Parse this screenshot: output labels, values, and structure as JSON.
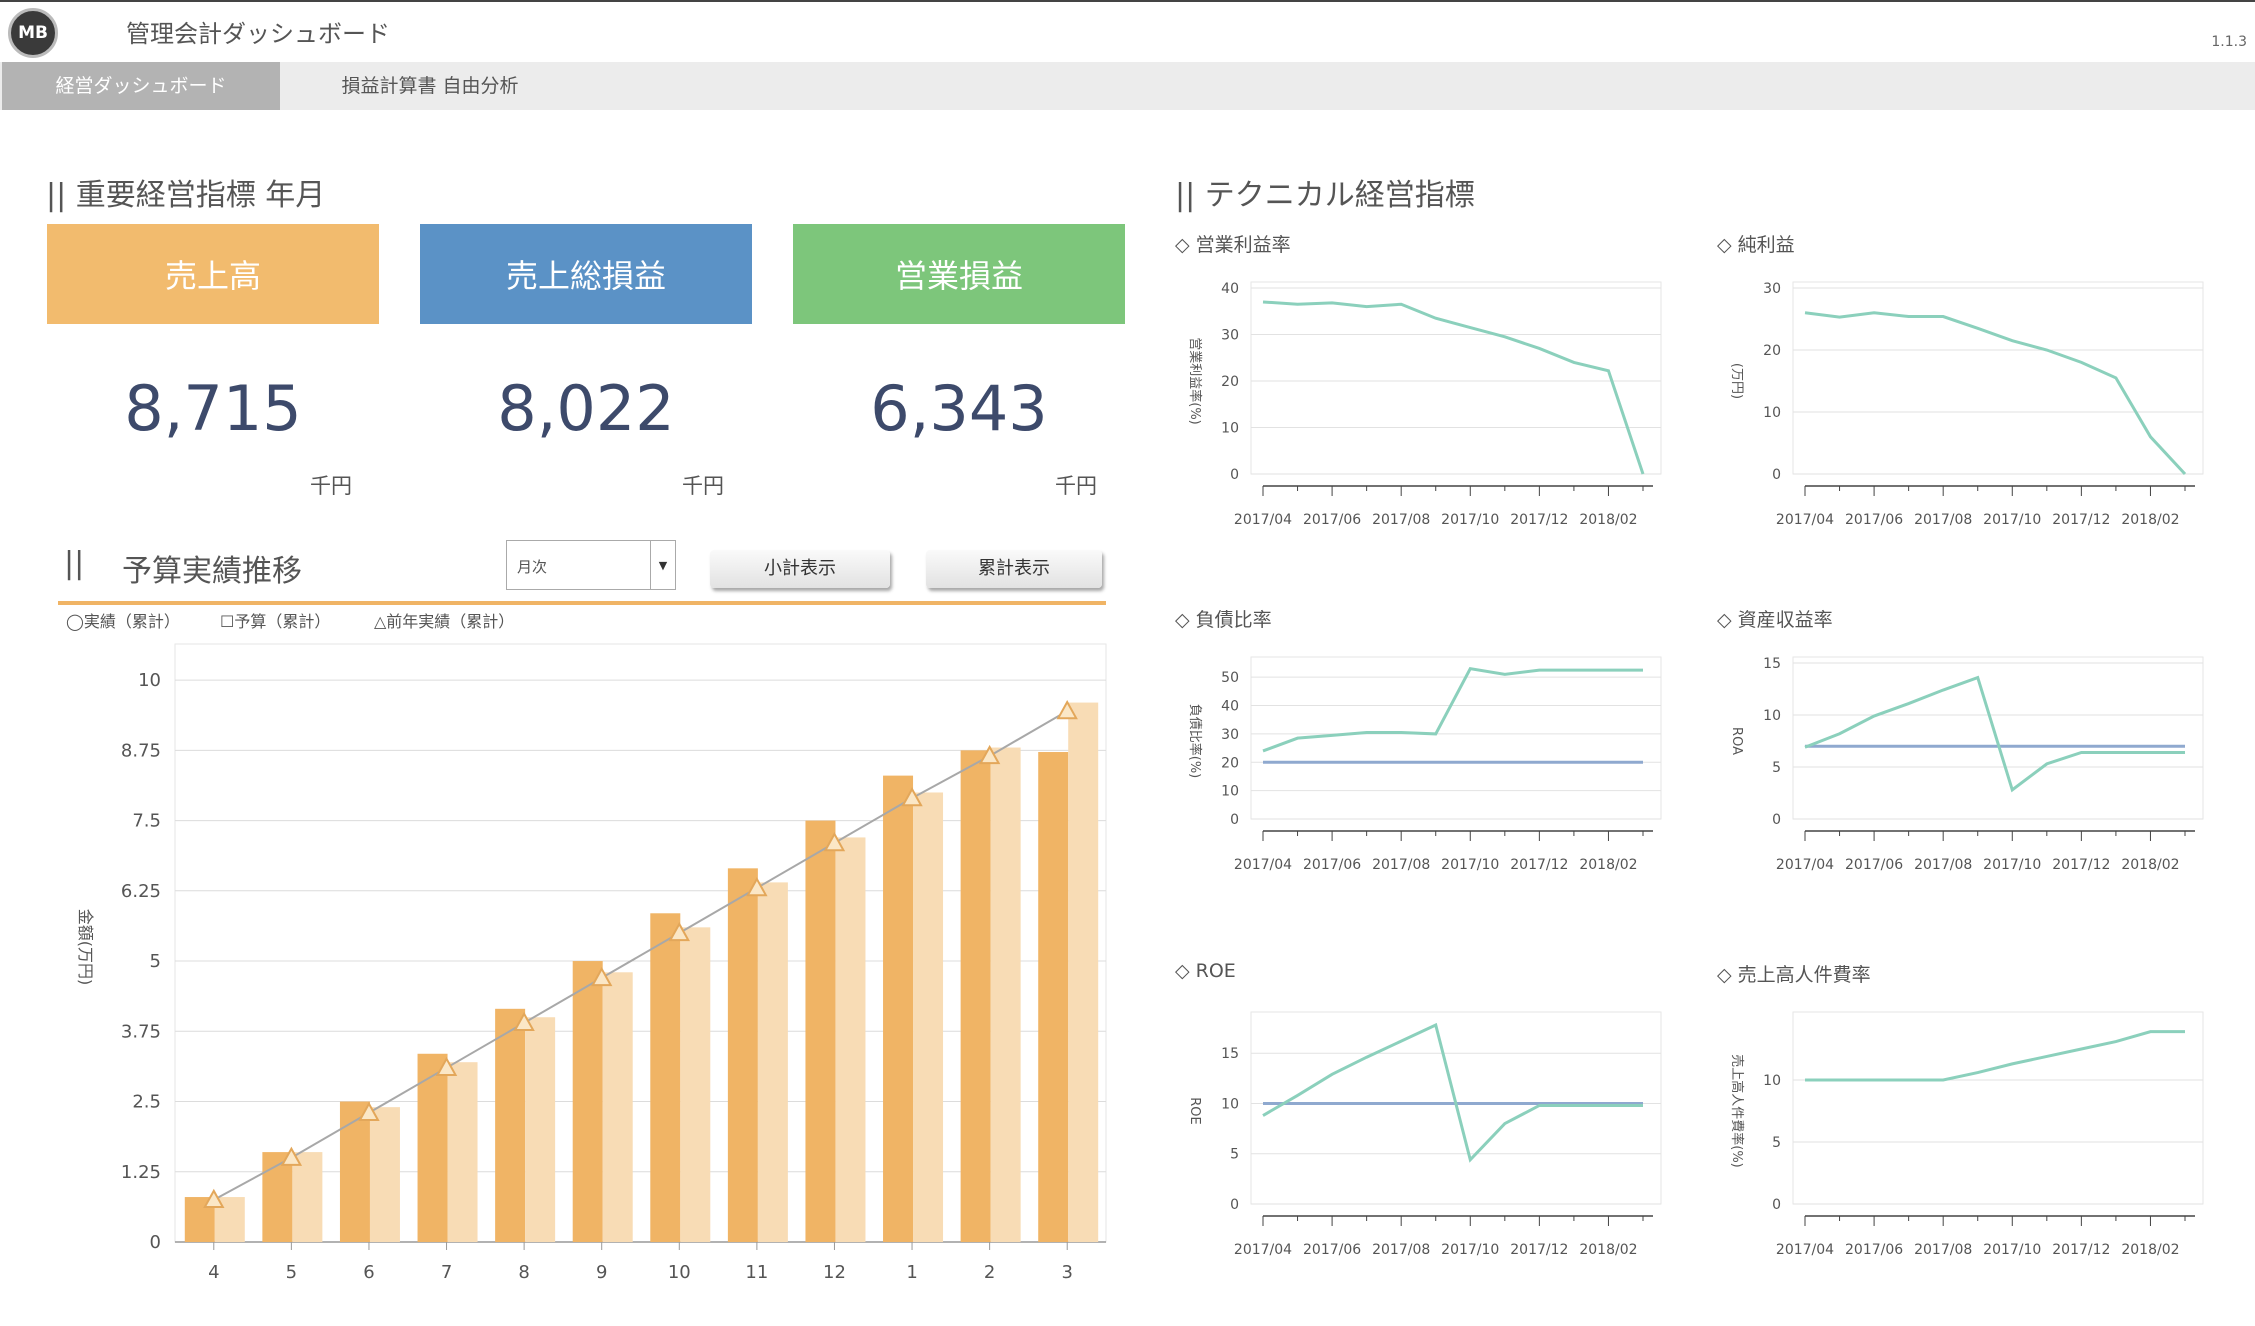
{
  "header": {
    "logo_text": "MB",
    "title": "管理会計ダッシュボード",
    "version": "1.1.3"
  },
  "tabs": [
    {
      "label": "経営ダッシュボード"
    },
    {
      "label": "損益計算書 自由分析"
    }
  ],
  "kpi_section": {
    "title": "|| 重要経営指標 年月",
    "cards": [
      {
        "label": "売上高",
        "value": "8,715",
        "unit": "千円",
        "color": "#f2bb6e"
      },
      {
        "label": "売上総損益",
        "value": "8,022",
        "unit": "千円",
        "color": "#5b92c6"
      },
      {
        "label": "営業損益",
        "value": "6,343",
        "unit": "千円",
        "color": "#7dc67b"
      }
    ]
  },
  "budget": {
    "title_bar": "||",
    "title": "予算実績推移",
    "select_value": "月次",
    "subtotal_button": "小計表示",
    "cumulative_button": "累計表示",
    "legend": [
      "◯実績（累計）",
      "☐予算（累計）",
      "△前年実績（累計）"
    ]
  },
  "tech_section": {
    "title": "|| テクニカル経営指標"
  },
  "colors": {
    "actual_bar": "#f0b465",
    "budget_bar": "#f8dcb5",
    "line": "#8bd0bc",
    "ref": "#8fa9cf",
    "triangle_line": "#a8a8a8"
  },
  "chart_data": [
    {
      "type": "bar",
      "id": "budget-actual",
      "categories": [
        "4",
        "5",
        "6",
        "7",
        "8",
        "9",
        "10",
        "11",
        "12",
        "1",
        "2",
        "3"
      ],
      "series": [
        {
          "name": "実績（累計）",
          "values": [
            0.8,
            1.6,
            2.5,
            3.35,
            4.15,
            5.0,
            5.85,
            6.65,
            7.5,
            8.3,
            8.75,
            8.72
          ]
        },
        {
          "name": "予算（累計）",
          "values": [
            0.8,
            1.6,
            2.4,
            3.2,
            4.0,
            4.8,
            5.6,
            6.4,
            7.2,
            8.0,
            8.8,
            9.6
          ]
        },
        {
          "name": "前年実績（累計）",
          "values": [
            0.75,
            1.5,
            2.3,
            3.1,
            3.9,
            4.7,
            5.5,
            6.3,
            7.1,
            7.9,
            8.65,
            9.45
          ]
        }
      ],
      "ylabel": "金額(万円)",
      "yticks": [
        "0",
        "1.25",
        "2.5",
        "3.75",
        "5",
        "6.25",
        "7.5",
        "8.75",
        "10"
      ],
      "ylim": [
        0,
        10.5
      ]
    },
    {
      "type": "line",
      "id": "operating-margin",
      "title": "◇ 営業利益率",
      "ylabel": "営業利益率(%)",
      "ylim": [
        0,
        40
      ],
      "yticks": [
        "0",
        "10",
        "20",
        "30",
        "40"
      ],
      "xticks": [
        "2017/04",
        "2017/06",
        "2017/08",
        "2017/10",
        "2017/12",
        "2018/02"
      ],
      "series": [
        {
          "values": [
            37,
            36.5,
            36.8,
            36,
            36.5,
            33.5,
            31.5,
            29.5,
            27,
            24,
            22.2,
            0
          ]
        }
      ]
    },
    {
      "type": "line",
      "id": "net-profit",
      "title": "◇ 純利益",
      "ylabel": "(万円)",
      "ylim": [
        0,
        30
      ],
      "yticks": [
        "0",
        "10",
        "20",
        "30"
      ],
      "xticks": [
        "2017/04",
        "2017/06",
        "2017/08",
        "2017/10",
        "2017/12",
        "2018/02"
      ],
      "series": [
        {
          "values": [
            26,
            25.3,
            26,
            25.4,
            25.4,
            23.5,
            21.5,
            20,
            18,
            15.5,
            6,
            0
          ]
        }
      ]
    },
    {
      "type": "line",
      "id": "debt-ratio",
      "title": "◇ 負債比率",
      "ylabel": "負債比率(%)",
      "ylim": [
        0,
        55
      ],
      "yticks": [
        "0",
        "10",
        "20",
        "30",
        "40",
        "50"
      ],
      "xticks": [
        "2017/04",
        "2017/06",
        "2017/08",
        "2017/10",
        "2017/12",
        "2018/02"
      ],
      "series": [
        {
          "values": [
            24,
            28.5,
            29.5,
            30.5,
            30.5,
            30,
            53,
            51,
            52.5,
            52.5,
            52.5,
            52.5
          ]
        }
      ],
      "reference": 20
    },
    {
      "type": "line",
      "id": "roa",
      "title": "◇ 資産収益率",
      "ylabel": "ROA",
      "ylim": [
        0,
        15
      ],
      "yticks": [
        "0",
        "5",
        "10",
        "15"
      ],
      "xticks": [
        "2017/04",
        "2017/06",
        "2017/08",
        "2017/10",
        "2017/12",
        "2018/02"
      ],
      "series": [
        {
          "values": [
            6.9,
            8.2,
            9.9,
            11.1,
            12.4,
            13.6,
            2.8,
            5.3,
            6.4,
            6.4,
            6.4,
            6.4
          ]
        }
      ],
      "reference": 7
    },
    {
      "type": "line",
      "id": "roe",
      "title": "◇ ROE",
      "ylabel": "ROE",
      "ylim": [
        0,
        18.5
      ],
      "yticks": [
        "0",
        "5",
        "10",
        "15"
      ],
      "xticks": [
        "2017/04",
        "2017/06",
        "2017/08",
        "2017/10",
        "2017/12",
        "2018/02"
      ],
      "series": [
        {
          "values": [
            8.8,
            10.8,
            12.9,
            14.6,
            16.2,
            17.8,
            4.4,
            8,
            9.8,
            9.8,
            9.8,
            9.8
          ]
        }
      ],
      "reference": 10
    },
    {
      "type": "line",
      "id": "personnel-ratio",
      "title": "◇ 売上高人件費率",
      "ylabel": "売上高人件費率(%)",
      "ylim": [
        0,
        15
      ],
      "yticks": [
        "0",
        "5",
        "10"
      ],
      "xticks": [
        "2017/04",
        "2017/06",
        "2017/08",
        "2017/10",
        "2017/12",
        "2018/02"
      ],
      "series": [
        {
          "values": [
            10,
            10,
            10,
            10,
            10,
            10.6,
            11.3,
            11.9,
            12.5,
            13.1,
            13.9,
            13.9
          ]
        }
      ]
    }
  ]
}
